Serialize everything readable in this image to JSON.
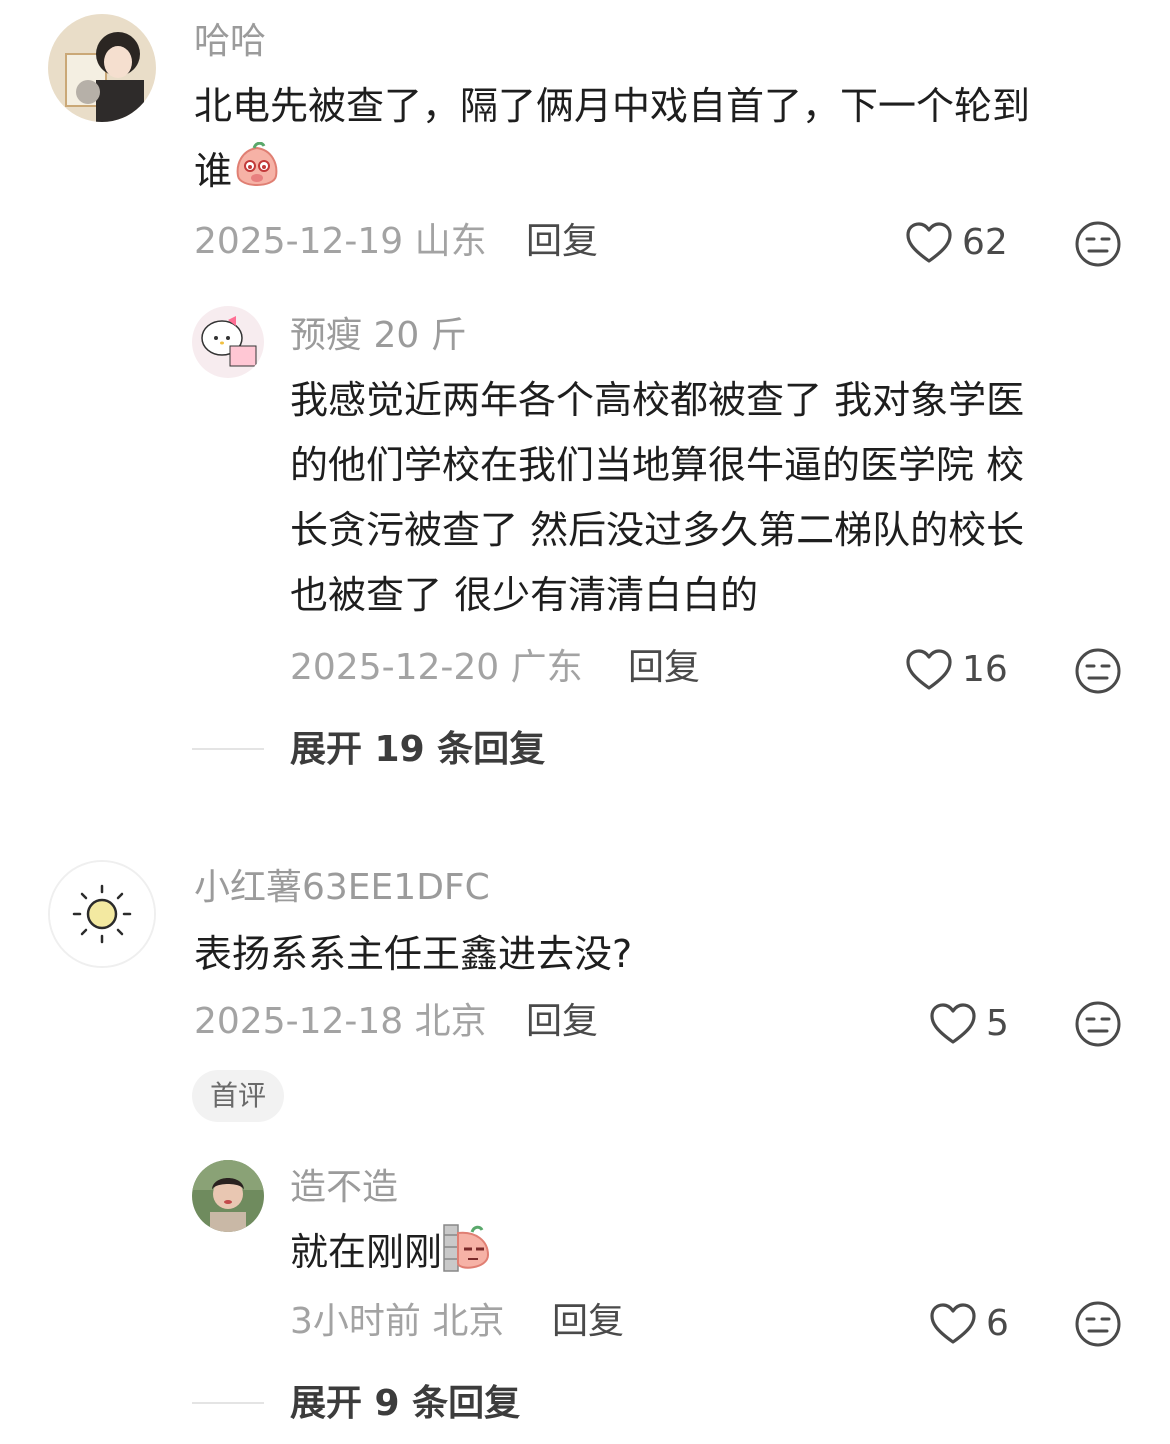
{
  "comments": [
    {
      "username": "哈哈",
      "text": "北电先被查了，隔了俩月中戏自首了，下一个轮到",
      "text_line2": "谁",
      "emoji": "shy-peach-emoji",
      "date_location": "2025-12-19 山东",
      "reply_label": "回复",
      "likes": "62",
      "sub_reply": {
        "username": "预瘦 20 斤",
        "lines": [
          "我感觉近两年各个高校都被查了 我对象学医",
          "的他们学校在我们当地算很牛逼的医学院 校",
          "长贪污被查了 然后没过多久第二梯队的校长",
          "也被查了 很少有清清白白的"
        ],
        "date_location": "2025-12-20 广东",
        "reply_label": "回复",
        "likes": "16"
      },
      "expand_label": "展开 19 条回复"
    },
    {
      "username": "小红薯63EE1DFC",
      "text": "表扬系系主任王鑫进去没?",
      "date_location": "2025-12-18 北京",
      "reply_label": "回复",
      "likes": "5",
      "badge": "首评",
      "sub_reply": {
        "username": "造不造",
        "text": "就在刚刚",
        "emoji": "peeking-peach-emoji",
        "date_location": "3小时前 北京",
        "reply_label": "回复",
        "likes": "6"
      },
      "expand_label": "展开 9 条回复"
    }
  ],
  "icons": {
    "like": "heart-outline-icon",
    "dislike": "meh-face-icon"
  },
  "colors": {
    "username": "#9b9b9b",
    "text": "#1e1e1e",
    "meta": "#a3a3a3"
  }
}
